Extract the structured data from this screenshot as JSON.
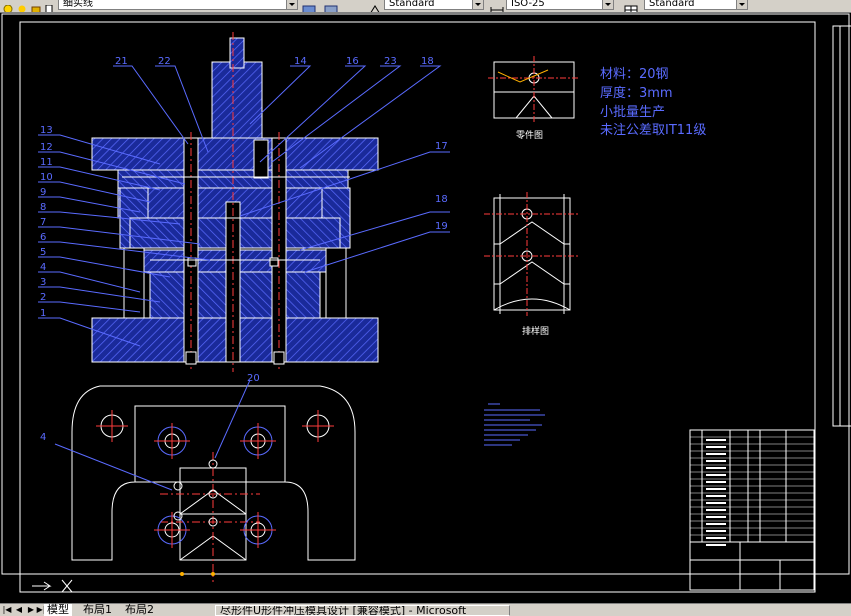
{
  "toolbar": {
    "layer_name": "细实线",
    "text_style": "Standard",
    "dim_style": "ISO-25",
    "table_style": "Standard"
  },
  "drawing": {
    "part_labels": [
      "1",
      "2",
      "3",
      "4",
      "5",
      "6",
      "7",
      "8",
      "9",
      "10",
      "11",
      "12",
      "13"
    ],
    "top_labels": [
      "21",
      "22",
      "14",
      "16",
      "23",
      "18"
    ],
    "right_labels": [
      "17",
      "18",
      "19"
    ],
    "plan_labels": [
      "20",
      "4"
    ],
    "notes": {
      "material": "材料：20钢",
      "thickness": "厚度：3mm",
      "production": "小批量生产",
      "tolerance": "未注公差取IT11级"
    },
    "part_view_caption": "零件图",
    "layout_view_caption": "排样图"
  },
  "tabs": {
    "model": "模型",
    "layout1": "布局1",
    "layout2": "布局2"
  },
  "taskbar": {
    "item": "尽形件U形件冲压模具设计 [兼容模式] - Microsoft"
  },
  "colors": {
    "background": "#000000",
    "hatch": "#4a5bff",
    "outline": "#ffffff",
    "center": "#ff3b3b",
    "accent": "#ffb000",
    "note": "#5a6bff"
  }
}
